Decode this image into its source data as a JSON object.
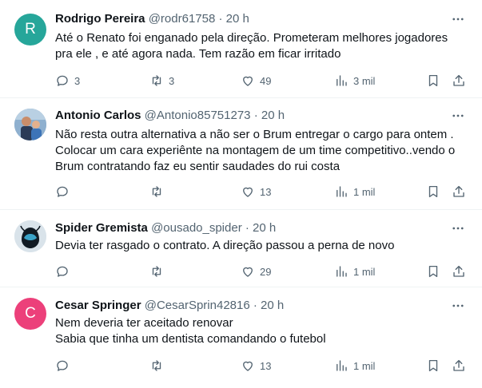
{
  "posts": [
    {
      "avatar_letter": "R",
      "avatar_color": "#26a69a",
      "name": "Rodrigo Pereira",
      "handle": "@rodr61758",
      "time": "20 h",
      "lines": [
        "Até o Renato foi enganado pela direção. Prometeram melhores jogadores",
        "pra ele , e até agora nada. Tem razão em ficar irritado"
      ],
      "replies": "3",
      "reposts": "3",
      "likes": "49",
      "views": "3 mil"
    },
    {
      "avatar_letter": "",
      "avatar_color": "#7a9bbd",
      "avatar_type": "photo",
      "name": "Antonio Carlos",
      "handle": "@Antonio85751273",
      "time": "20 h",
      "lines": [
        "Não resta outra alternativa a não ser o Brum entregar o cargo para ontem .",
        "Colocar um cara experiênte na montagem de um time competitivo..vendo o",
        "Brum contratando faz eu sentir saudades do rui costa"
      ],
      "replies": "",
      "reposts": "",
      "likes": "13",
      "views": "1 mil"
    },
    {
      "avatar_letter": "",
      "avatar_color": "#d9e3ea",
      "avatar_type": "spider",
      "name": "Spider Gremista",
      "handle": "@ousado_spider",
      "time": "20 h",
      "lines": [
        "Devia ter rasgado o contrato. A direção passou a perna de novo"
      ],
      "replies": "",
      "reposts": "",
      "likes": "29",
      "views": "1 mil"
    },
    {
      "avatar_letter": "C",
      "avatar_color": "#ec407a",
      "name": "Cesar Springer",
      "handle": "@CesarSprin42816",
      "time": "20 h",
      "lines": [
        "Nem deveria ter aceitado renovar",
        "Sabia que tinha um dentista comandando o futebol"
      ],
      "replies": "",
      "reposts": "",
      "likes": "13",
      "views": "1 mil"
    }
  ],
  "separator": "·",
  "icons": {
    "more": "more-horizontal-icon",
    "reply": "reply-bubble-icon",
    "repost": "repost-arrows-icon",
    "like": "heart-icon",
    "views": "bar-chart-icon",
    "bookmark": "bookmark-icon",
    "share": "share-upload-icon"
  },
  "colors": {
    "text": "#0f1419",
    "muted": "#536471",
    "divider": "#eff3f4"
  }
}
